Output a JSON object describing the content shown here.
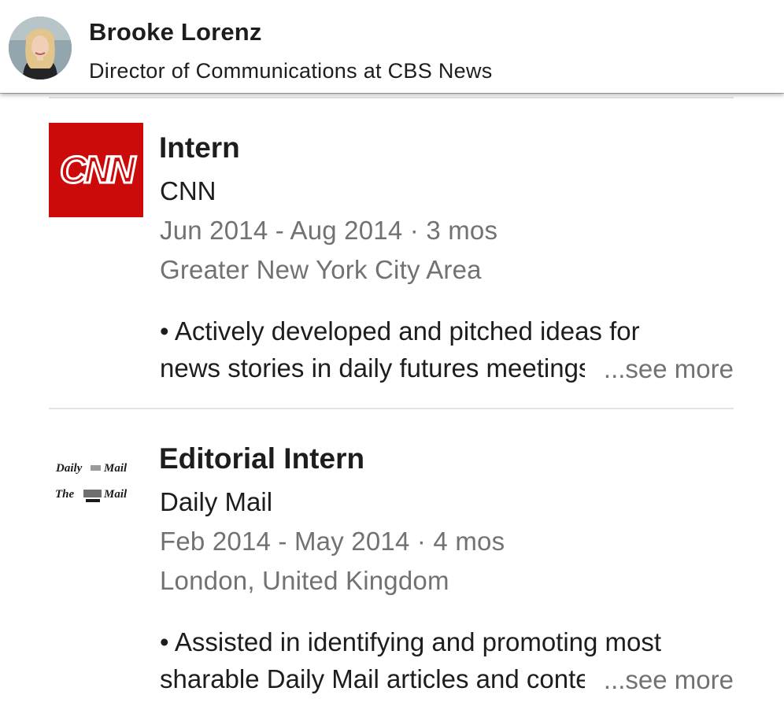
{
  "header": {
    "name": "Brooke Lorenz",
    "headline": "Director of Communications at CBS News"
  },
  "experience": [
    {
      "logo_icon": "cnn-logo",
      "logo_text": "CNN",
      "title": "Intern",
      "company": "CNN",
      "dates": "Jun 2014 - Aug 2014 · 3 mos",
      "location": "Greater New York City Area",
      "description_line1": "• Actively developed and pitched ideas for",
      "description_line2": "news stories in daily futures meetings",
      "see_more": "...see more"
    },
    {
      "logo_icon": "daily-mail-logo",
      "logo_text_1": "Daily",
      "logo_text_2": "Mail",
      "logo_text_3": "The",
      "logo_text_4": "Mail",
      "title": "Editorial Intern",
      "company": "Daily Mail",
      "dates": "Feb 2014 - May 2014 · 4 mos",
      "location": "London, United Kingdom",
      "description_line1": "• Assisted in identifying and promoting most",
      "description_line2": "sharable Daily Mail articles and content",
      "see_more": "...see more"
    }
  ],
  "colors": {
    "cnn_red": "#cc0a0a",
    "secondary_text": "#727272",
    "primary_text": "#1d1d1d"
  }
}
